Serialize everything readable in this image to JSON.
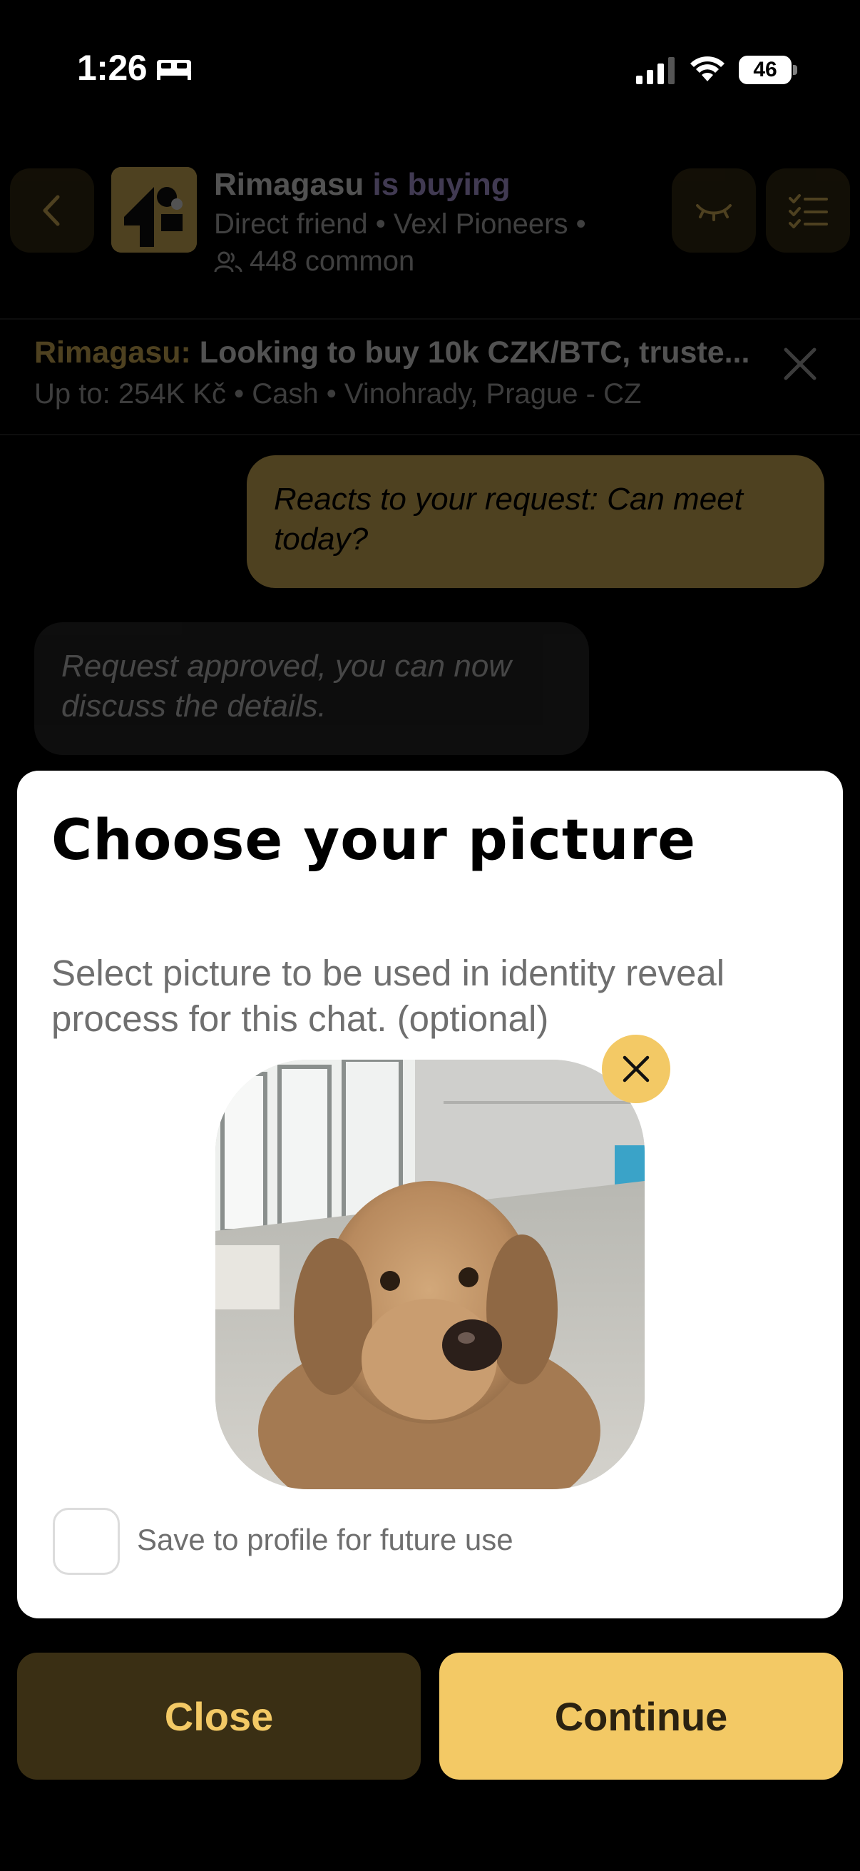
{
  "status_bar": {
    "time": "1:26",
    "battery": "46",
    "icons": [
      "bed-icon",
      "cellular-signal-icon",
      "wifi-icon",
      "battery-icon"
    ]
  },
  "header": {
    "name": "Rimagasu",
    "action": "is buying",
    "relation": "Direct friend",
    "group": "Vexl Pioneers",
    "separator": "•",
    "common_count": "448 common",
    "icons": [
      "back-chevron-icon",
      "people-icon",
      "hide-eye-icon",
      "checklist-icon"
    ]
  },
  "offer": {
    "name": "Rimagasu:",
    "text": "Looking to buy 10k CZK/BTC, truste...",
    "details": "Up to: 254K Kč  •  Cash  •  Vinohrady, Prague - CZ",
    "close_icon": "close-icon"
  },
  "messages": [
    {
      "from": "me",
      "text": "Reacts to your request: Can meet today?"
    },
    {
      "from": "system",
      "text": "Request approved, you can now discuss the details."
    }
  ],
  "modal": {
    "title": "Choose your picture",
    "description": "Select picture to be used in identity reveal process for this chat. (optional)",
    "remove_icon": "close-icon",
    "checkbox_label": "Save to profile for future use",
    "checkbox_checked": false
  },
  "buttons": {
    "close": "Close",
    "continue": "Continue"
  },
  "colors": {
    "accent": "#f3c965",
    "accent_dark": "#3a2f14",
    "background": "#000000",
    "modal": "#ffffff"
  }
}
